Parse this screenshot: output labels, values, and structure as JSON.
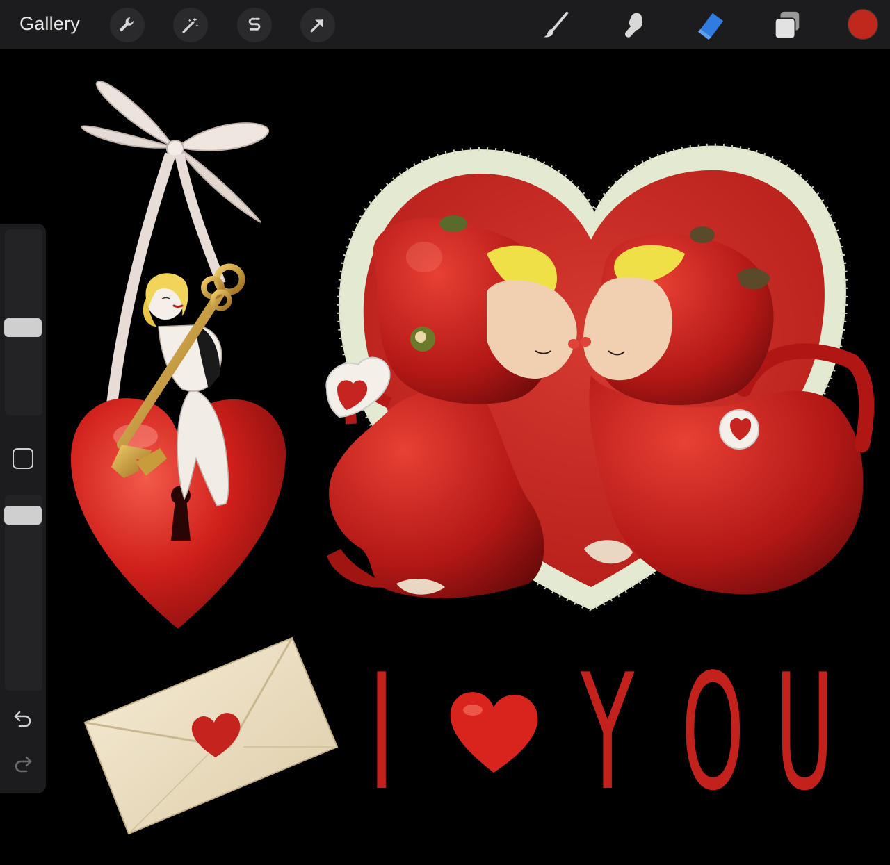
{
  "toolbar": {
    "gallery_label": "Gallery",
    "left_tools": [
      {
        "name": "actions",
        "icon": "wrench-icon"
      },
      {
        "name": "adjustments",
        "icon": "magic-wand-icon"
      },
      {
        "name": "selection",
        "icon": "selection-s-icon"
      },
      {
        "name": "transform",
        "icon": "arrow-cursor-icon"
      }
    ],
    "right_tools": [
      {
        "name": "brush",
        "icon": "brush-icon",
        "active": false
      },
      {
        "name": "smudge",
        "icon": "smudge-finger-icon",
        "active": false
      },
      {
        "name": "eraser",
        "icon": "eraser-icon",
        "active": true
      },
      {
        "name": "layers",
        "icon": "layers-icon",
        "active": false
      }
    ],
    "current_color": "#c0281e",
    "active_color": "#2f7de1"
  },
  "sidebar": {
    "brush_size_level": 0.5,
    "opacity_level": 0.06,
    "icons": [
      "undo-arrow-icon",
      "redo-arrow-icon"
    ]
  },
  "canvas": {
    "lettering": {
      "letters": [
        "I",
        "Y",
        "O",
        "U"
      ]
    },
    "background_color": "#000000"
  }
}
